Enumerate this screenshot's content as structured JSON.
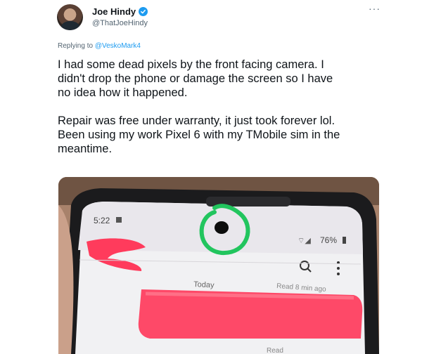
{
  "author": {
    "display_name": "Joe Hindy",
    "handle": "@ThatJoeHindy",
    "verified": true,
    "avatar_icon": "profile-photo"
  },
  "reply": {
    "prefix": "Replying to ",
    "mention": "@VeskoMark4"
  },
  "more_icon": "ellipsis-icon",
  "tweet": {
    "paragraph_1": "I had some dead pixels by the front facing camera. I\ndidn't drop the phone or damage the screen so I have\nno idea how it happened.",
    "paragraph_2": "Repair was free under warranty, it just took forever lol.\nBeen using my work Pixel 6 with my TMobile sim in the\nmeantime."
  },
  "photo": {
    "status_time": "5:22",
    "battery": "76%",
    "date_divider": "Today",
    "read_receipt": "Read 8 min ago",
    "read_partial": "Read",
    "annotation_color": "#22c55e",
    "redaction_color": "#ff3b5c"
  }
}
